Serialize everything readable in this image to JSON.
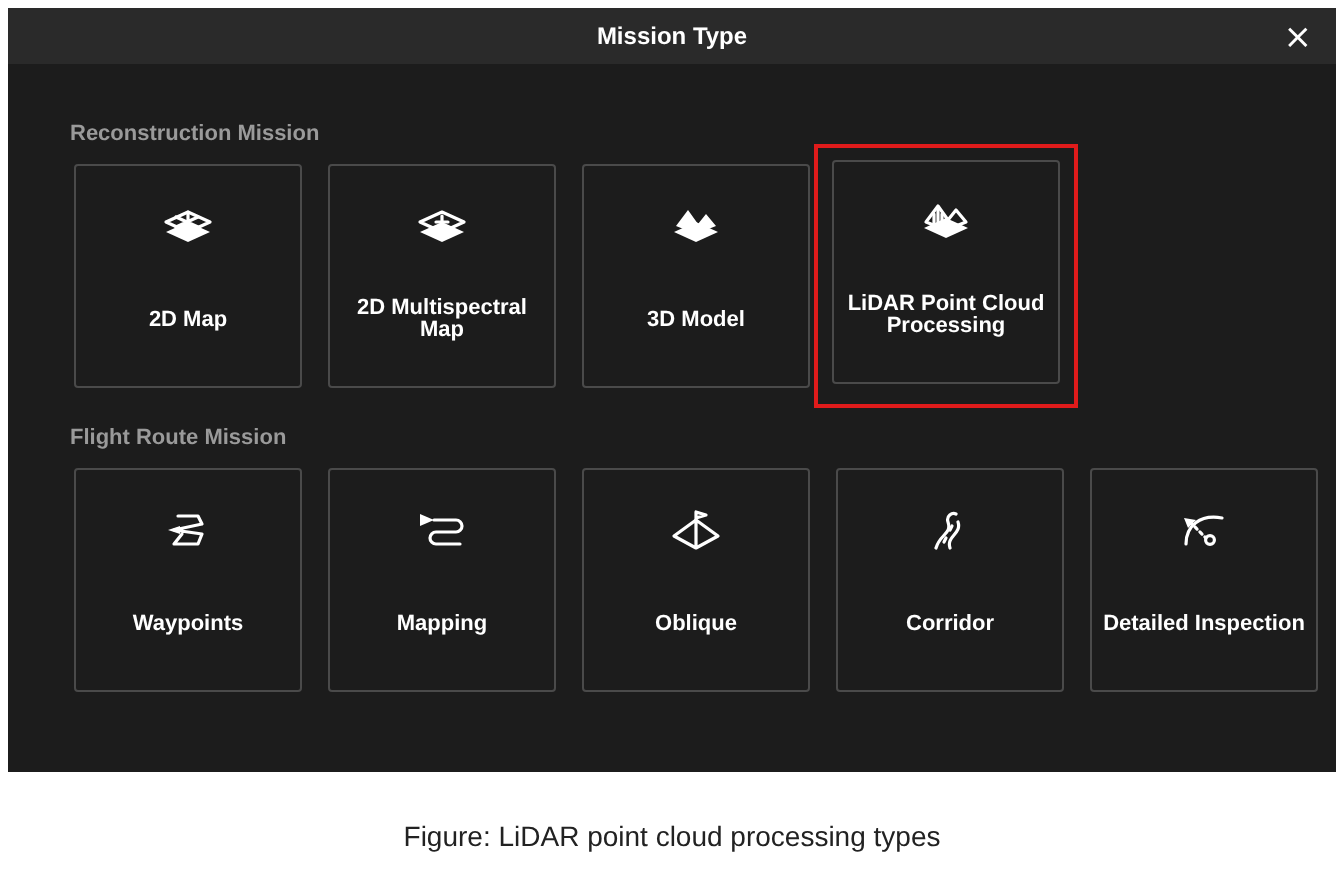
{
  "dialog": {
    "title": "Mission Type",
    "close": "×"
  },
  "sections": [
    {
      "label": "Reconstruction Mission",
      "tiles": [
        {
          "label": "2D Map",
          "highlighted": false
        },
        {
          "label": "2D Multispectral Map",
          "highlighted": false
        },
        {
          "label": "3D Model",
          "highlighted": false
        },
        {
          "label": "LiDAR Point Cloud Processing",
          "highlighted": true
        }
      ]
    },
    {
      "label": "Flight Route Mission",
      "tiles": [
        {
          "label": "Waypoints",
          "highlighted": false
        },
        {
          "label": "Mapping",
          "highlighted": false
        },
        {
          "label": "Oblique",
          "highlighted": false
        },
        {
          "label": "Corridor",
          "highlighted": false
        },
        {
          "label": "Detailed Inspection",
          "highlighted": false
        }
      ]
    }
  ],
  "caption": "Figure: LiDAR point cloud processing types"
}
